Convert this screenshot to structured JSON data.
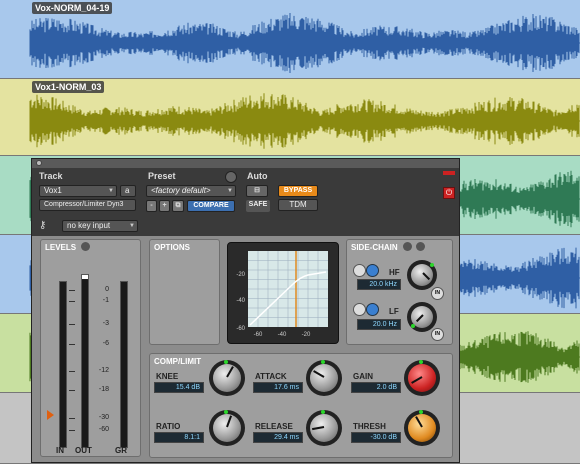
{
  "tracks": [
    {
      "name": "Vox-NORM_04-19",
      "color": "#2f5fa5",
      "bg": "#a8c8ec"
    },
    {
      "name": "Vox1-NORM_03",
      "color": "#8a8a10",
      "bg": "#e4e3a0"
    }
  ],
  "plugin": {
    "track_header": "Track",
    "preset_header": "Preset",
    "auto_header": "Auto",
    "track_name": "Vox1",
    "track_channel": "a",
    "insert_name": "Compressor/Limiter Dyn3",
    "preset_name": "<factory default>",
    "compare_label": "COMPARE",
    "safe_label": "SAFE",
    "bypass_label": "BYPASS",
    "format_label": "TDM",
    "key_input": "no key input",
    "levels_title": "LEVELS",
    "options_title": "OPTIONS",
    "sidechain_title": "SIDE-CHAIN",
    "complimit_title": "COMP/LIMIT",
    "meter_scale": [
      "0",
      "-1",
      "-3",
      "-6",
      "-12",
      "-18",
      "-30",
      "-60"
    ],
    "meter_labels": {
      "in": "IN",
      "out": "OUT",
      "gr": "GR"
    },
    "graph_y": [
      "-20",
      "-40",
      "-60"
    ],
    "graph_x": [
      "-60",
      "-40",
      "-20"
    ],
    "hf_label": "HF",
    "hf_value": "20.0 kHz",
    "lf_label": "LF",
    "lf_value": "20.0 Hz",
    "in_label": "IN",
    "knee_label": "KNEE",
    "knee_value": "15.4 dB",
    "attack_label": "ATTACK",
    "attack_value": "17.6 ms",
    "gain_label": "GAIN",
    "gain_value": "2.0 dB",
    "ratio_label": "RATIO",
    "ratio_value": "8.1:1",
    "release_label": "RELEASE",
    "release_value": "29.4 ms",
    "thresh_label": "THRESH",
    "thresh_value": "-30.0 dB"
  }
}
